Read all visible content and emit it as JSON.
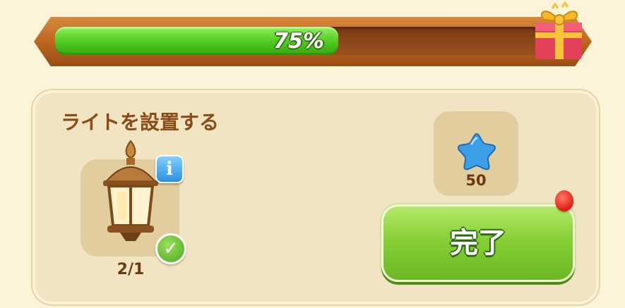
{
  "progress": {
    "label": "75%",
    "value": 0.75,
    "reward_icon": "gift-box-icon"
  },
  "task": {
    "title": "ライトを設置する"
  },
  "item": {
    "icon": "street-lantern-icon",
    "count": "2/1",
    "info_icon": "info-icon",
    "complete_icon": "checkmark-icon"
  },
  "reward": {
    "icon": "blue-star-icon",
    "amount": "50"
  },
  "actions": {
    "done_label": "完了"
  },
  "colors": {
    "progress_fill": "#4fc81f",
    "button_green": "#86cf36",
    "text_brown": "#8a4b17",
    "notification_red": "#e01b12"
  }
}
